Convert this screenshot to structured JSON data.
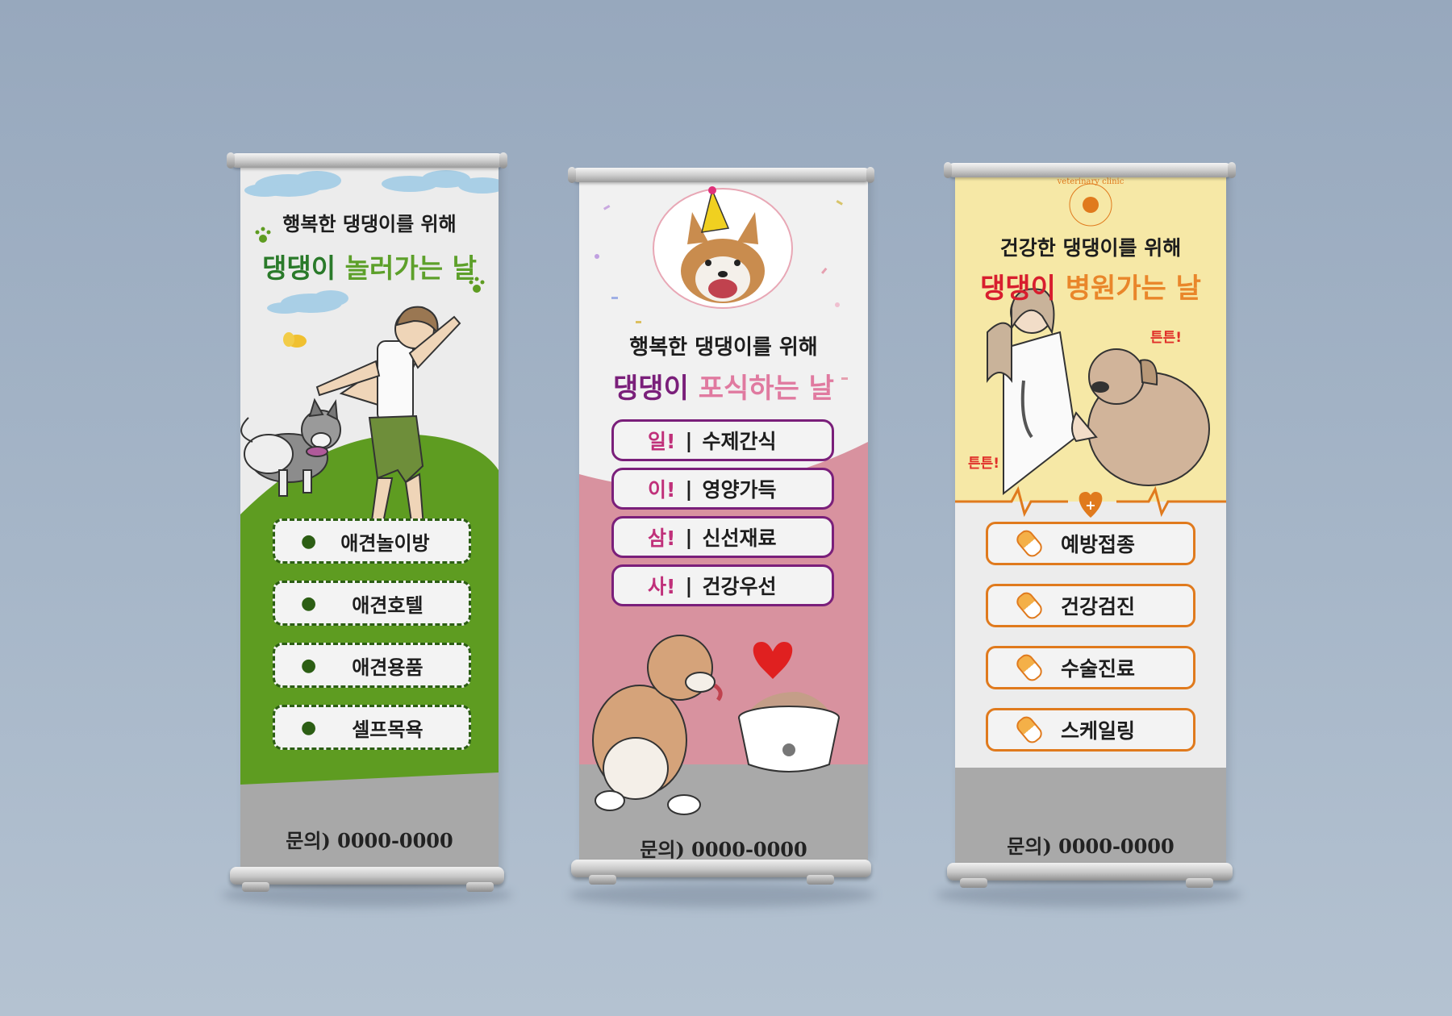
{
  "colors": {
    "background": "#a2b2c5",
    "green": "#5a9a1f",
    "purple": "#7a1f7a",
    "pink": "#d9919f",
    "orange": "#e07a1d",
    "yellow": "#f6e8a6",
    "gray": "#a9a9a9"
  },
  "banner1": {
    "subtitle": "행복한 댕댕이를 위해",
    "title_a": "댕댕이",
    "title_b": "놀러가는 날",
    "items": [
      "애견놀이방",
      "애견호텔",
      "애견용품",
      "셀프목욕"
    ],
    "item_icon": "paw-icon",
    "contact": "문의) 0000-0000"
  },
  "banner2": {
    "subtitle": "행복한 댕댕이를 위해",
    "title_a": "댕댕이",
    "title_b": "포식하는 날",
    "items": [
      {
        "num": "일!",
        "label": "수제간식"
      },
      {
        "num": "이!",
        "label": "영양가득"
      },
      {
        "num": "삼!",
        "label": "신선재료"
      },
      {
        "num": "사!",
        "label": "건강우선"
      }
    ],
    "contact": "문의) 0000-0000"
  },
  "banner3": {
    "logo_text": "veterinary clinic",
    "subtitle": "건강한 댕댕이를 위해",
    "title_a": "댕댕이",
    "title_b": "병원가는 날",
    "tag1": "튼튼!",
    "tag2": "튼튼!",
    "items": [
      "예방접종",
      "건강검진",
      "수술진료",
      "스케일링"
    ],
    "item_icon": "pill-icon",
    "contact": "문의) 0000-0000"
  }
}
